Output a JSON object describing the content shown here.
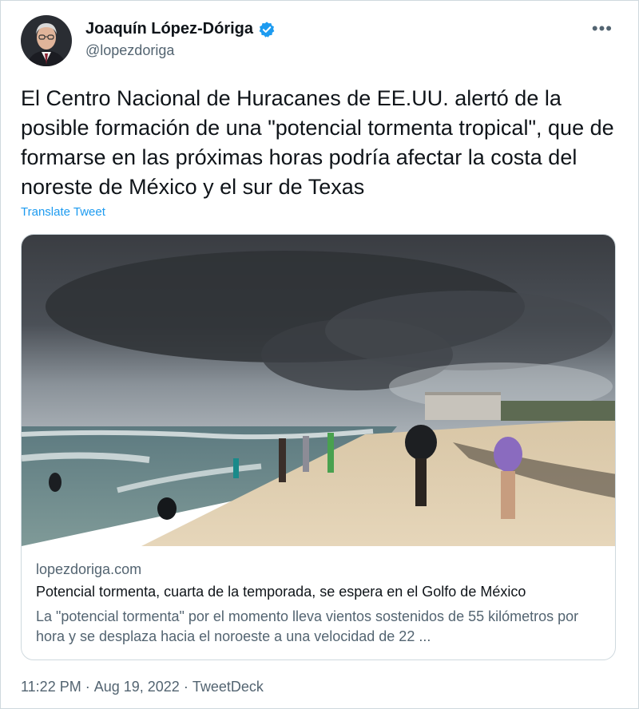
{
  "author": {
    "name": "Joaquín López-Dóriga",
    "handle": "@lopezdoriga",
    "verified": true
  },
  "more_icon": "more-horizontal-icon",
  "tweet": {
    "text": "El Centro Nacional de Huracanes de EE.UU. alertó de la posible formación de una \"potencial tormenta tropical\", que de formarse en las próximas horas podría afectar la costa del noreste de México y el sur de Texas",
    "translate_label": "Translate Tweet"
  },
  "card": {
    "domain": "lopezdoriga.com",
    "title": "Potencial tormenta, cuarta de la temporada, se espera en el Golfo de México",
    "description": "La \"potencial tormenta\" por el momento lleva vientos sostenidos de 55 kilómetros por hora y se desplaza hacia el noroeste a una velocidad de 22 ..."
  },
  "meta": {
    "time": "11:22 PM",
    "date": "Aug 19, 2022",
    "separator": "·",
    "source": "TweetDeck"
  },
  "colors": {
    "accent": "#1d9bf0",
    "text": "#0f1419",
    "secondary": "#536471",
    "border": "#cfd9de"
  }
}
